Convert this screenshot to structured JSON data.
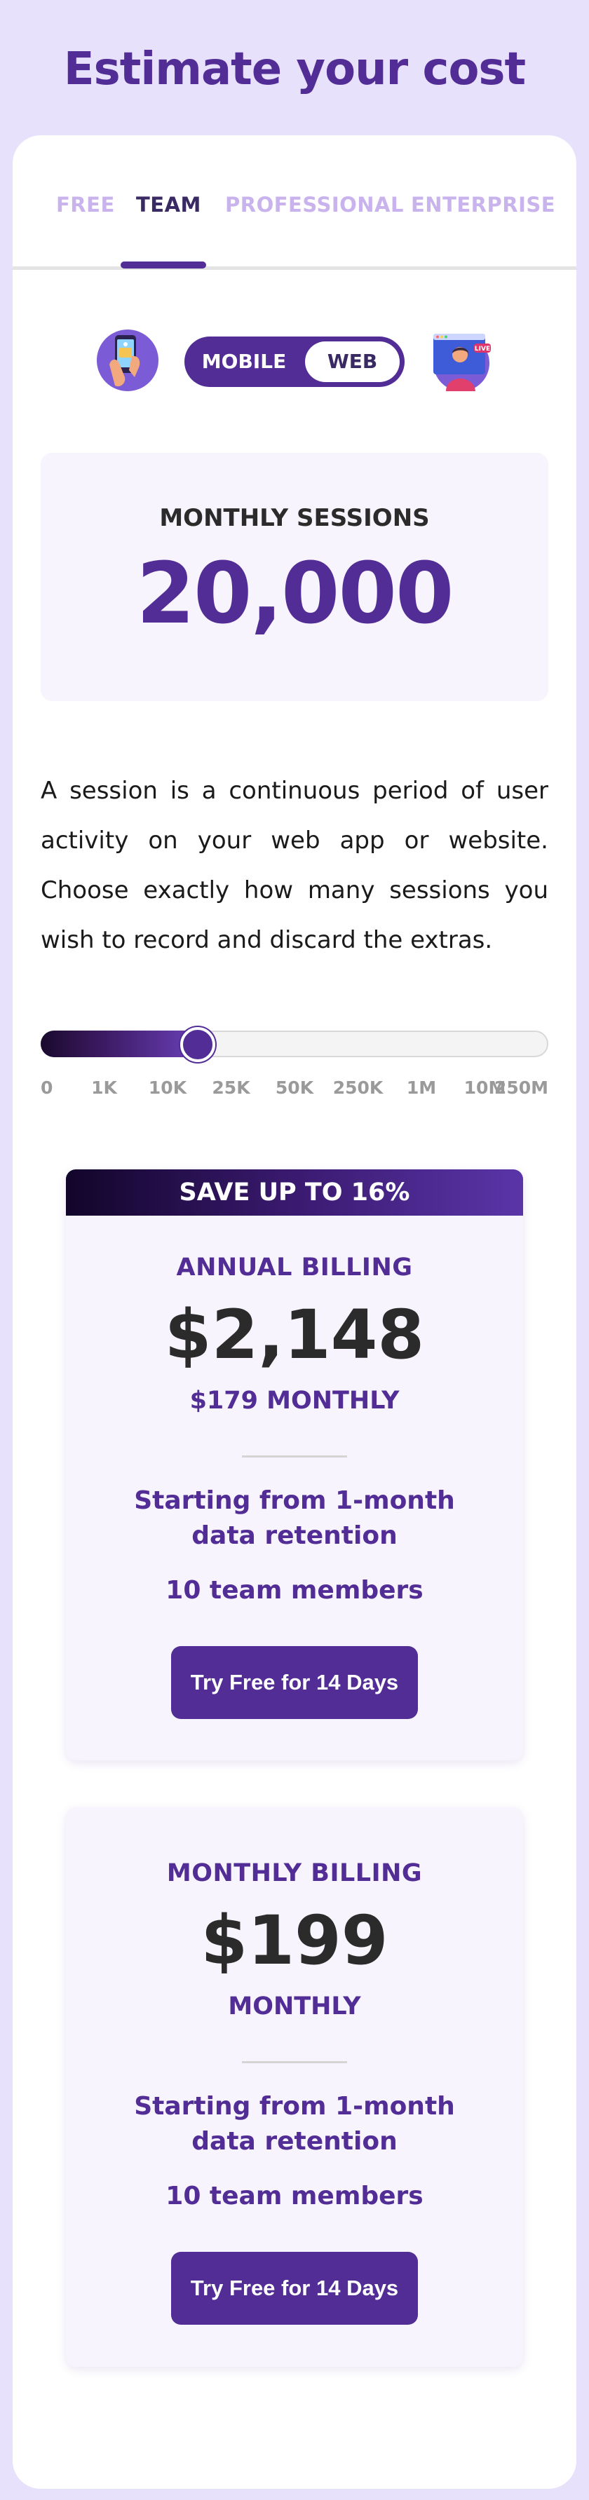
{
  "page": {
    "title": "Estimate your cost"
  },
  "tabs": [
    {
      "label": "FREE",
      "active": false
    },
    {
      "label": "TEAM",
      "active": true
    },
    {
      "label": "PROFESSIONAL",
      "active": false
    },
    {
      "label": "ENTERPRISE",
      "active": false
    }
  ],
  "platform": {
    "options": [
      {
        "label": "MOBILE"
      },
      {
        "label": "WEB"
      }
    ],
    "selected": "WEB",
    "mobile_icon": "phone-hand-icon",
    "web_icon": "browser-live-icon",
    "live_badge": "LIVE"
  },
  "sessions": {
    "label": "MONTHLY SESSIONS",
    "value": "20,000"
  },
  "description": "A session is a continuous period of user activity on your web app or website. Choose exactly how many sessions you wish to record and discard the extras.",
  "slider": {
    "ticks": [
      "0",
      "1K",
      "10K",
      "25K",
      "50K",
      "250K",
      "1M",
      "10M",
      "250M"
    ],
    "selected_value": "20,000",
    "position_fraction": 0.31
  },
  "annual_plan": {
    "banner": "SAVE UP TO 16%",
    "title": "ANNUAL BILLING",
    "price": "$2,148",
    "subtitle": "$179 MONTHLY",
    "retention": "Starting from 1-month data retention",
    "members": "10 team members",
    "cta": "Try Free for 14 Days"
  },
  "monthly_plan": {
    "title": "MONTHLY BILLING",
    "price": "$199",
    "subtitle": "MONTHLY",
    "retention": "Starting from 1-month data retention",
    "members": "10 team members",
    "cta": "Try Free for 14 Days"
  },
  "colors": {
    "brand": "#522d96",
    "page_background": "#e8e1fc",
    "inactive_tab": "#c9b3ec",
    "card_tint": "#f7f4fd"
  }
}
